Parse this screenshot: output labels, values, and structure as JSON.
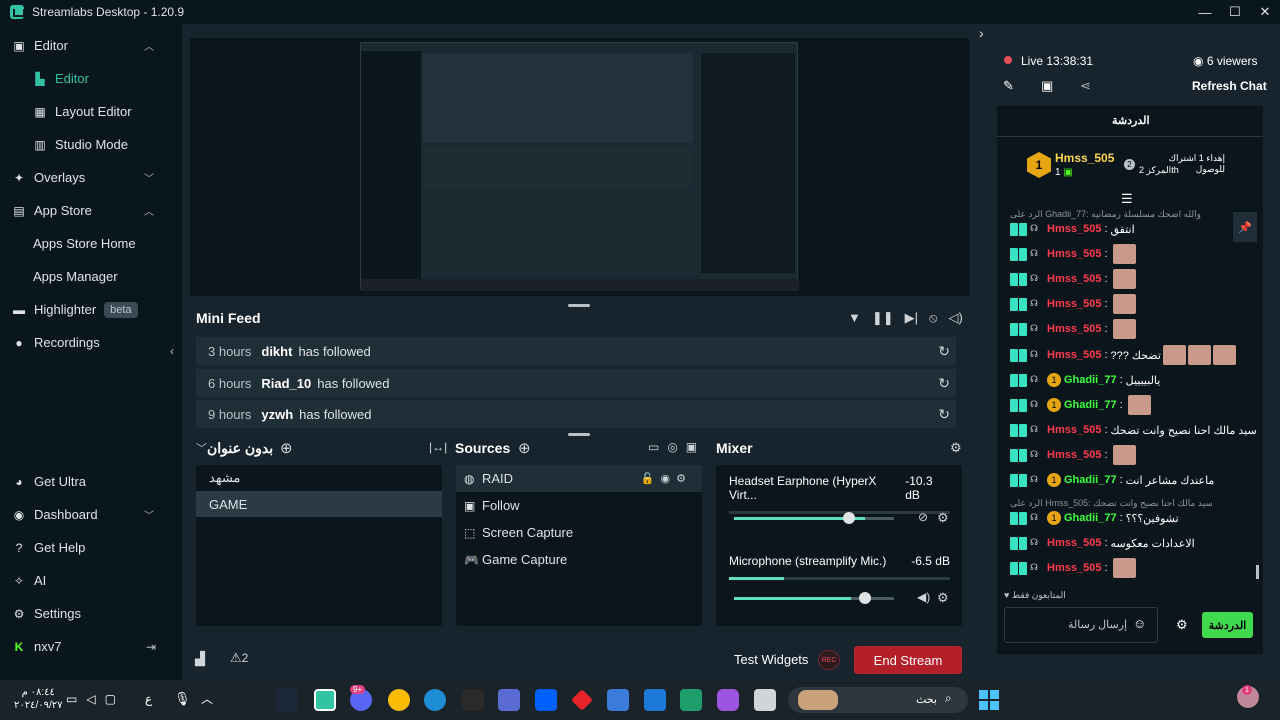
{
  "app": {
    "title": "Streamlabs Desktop - 1.20.9"
  },
  "window_buttons": [
    "—",
    "☐",
    "✕"
  ],
  "sidebar": {
    "editor_group": "Editor",
    "editor": "Editor",
    "layout_editor": "Layout Editor",
    "studio_mode": "Studio Mode",
    "overlays": "Overlays",
    "app_store": "App Store",
    "apps_store_home": "Apps Store Home",
    "apps_manager": "Apps Manager",
    "highlighter": "Highlighter",
    "highlighter_badge": "beta",
    "recordings": "Recordings",
    "get_ultra": "Get Ultra",
    "dashboard": "Dashboard",
    "get_help": "Get Help",
    "ai": "AI",
    "settings": "Settings",
    "user": "nxv7"
  },
  "mini_feed": {
    "title": "Mini Feed",
    "rows": [
      {
        "time": "3 hours",
        "name": "dikht",
        "action": "has followed"
      },
      {
        "time": "6 hours",
        "name": "Riad_10",
        "action": "has followed"
      },
      {
        "time": "9 hours",
        "name": "yzwh",
        "action": "has followed"
      }
    ]
  },
  "scenes": {
    "title": "بدون عنوان",
    "items": [
      "مشهد",
      "GAME"
    ]
  },
  "sources": {
    "title": "Sources",
    "items": [
      "RAID",
      "Follow",
      "Screen Capture",
      "Game Capture"
    ]
  },
  "mixer": {
    "title": "Mixer",
    "rows": [
      {
        "name": "Headset Earphone (HyperX Virt...",
        "db": "-10.3 dB",
        "level": 0.82
      },
      {
        "name": "Microphone (streamplify Mic.)",
        "db": "-6.5 dB",
        "level": 0.73
      }
    ]
  },
  "footer": {
    "test_widgets": "Test Widgets",
    "rec": "REC",
    "end_stream": "End Stream",
    "alerts_count": "2"
  },
  "chat": {
    "live_label": "Live",
    "live_time": "13:38:31",
    "viewers": "6 viewers",
    "refresh": "Refresh Chat",
    "header": "الدردشة",
    "top_user": "Hmss_505",
    "top_user_count": "1",
    "top_rank": "1",
    "gift_text": "إهداء 1 اشتراك للوصول",
    "gift_rank": "المركز 2th",
    "gift_rank_badge": "2",
    "reply_1": "الرد على Ghadii_77: والله اضحك مسلسلة رمضانيه",
    "reply_2": "الرد على Hmss_505: سيد مالك احنا نصيح وانت تضحك",
    "messages": [
      {
        "user": "Hmss_505",
        "text": "انتقق",
        "color": "#ff3b4e",
        "sub": false
      },
      {
        "user": "Hmss_505",
        "text": "",
        "color": "#ff3b4e",
        "sub": false
      },
      {
        "user": "Hmss_505",
        "text": "",
        "color": "#ff3b4e",
        "sub": false
      },
      {
        "user": "Hmss_505",
        "text": "",
        "color": "#ff3b4e",
        "sub": false
      },
      {
        "user": "Hmss_505",
        "text": "",
        "color": "#ff3b4e",
        "sub": false
      },
      {
        "user": "Hmss_505",
        "text": "??? تضحك",
        "color": "#ff3b4e",
        "sub": false
      },
      {
        "user": "Ghadii_77",
        "text": "يالبييييل",
        "color": "#39ff3b",
        "sub": true
      },
      {
        "user": "Ghadii_77",
        "text": "",
        "color": "#39ff3b",
        "sub": true
      },
      {
        "user": "Hmss_505",
        "text": "سيد مالك احنا نصيح وانت تضحك",
        "color": "#ff3b4e",
        "sub": false
      },
      {
        "user": "Hmss_505",
        "text": "",
        "color": "#ff3b4e",
        "sub": false
      },
      {
        "user": "Ghadii_77",
        "text": "ماعندك مشاعر انت",
        "color": "#39ff3b",
        "sub": true
      },
      {
        "user": "Ghadii_77",
        "text": "تشوفين؟؟؟",
        "color": "#39ff3b",
        "sub": true
      },
      {
        "user": "Hmss_505",
        "text": "الاعدادات معكوسه",
        "color": "#ff3b4e",
        "sub": false
      },
      {
        "user": "Hmss_505",
        "text": "",
        "color": "#ff3b4e",
        "sub": false
      }
    ],
    "followers_only": "المتابعون فقط",
    "input_placeholder": "إرسال رسالة",
    "send_button": "الدردشة"
  },
  "taskbar": {
    "time": "٠٨:٤٤ م",
    "date": "٢٠٢٤/٠٩/٢٧",
    "lang": "ع",
    "search_placeholder": "بحث",
    "discord_badge": "9+",
    "tray_badge": "1"
  },
  "colors": {
    "accent": "#31c3a2",
    "end_stream": "#b3202a",
    "chat_send": "#3fd94f"
  }
}
